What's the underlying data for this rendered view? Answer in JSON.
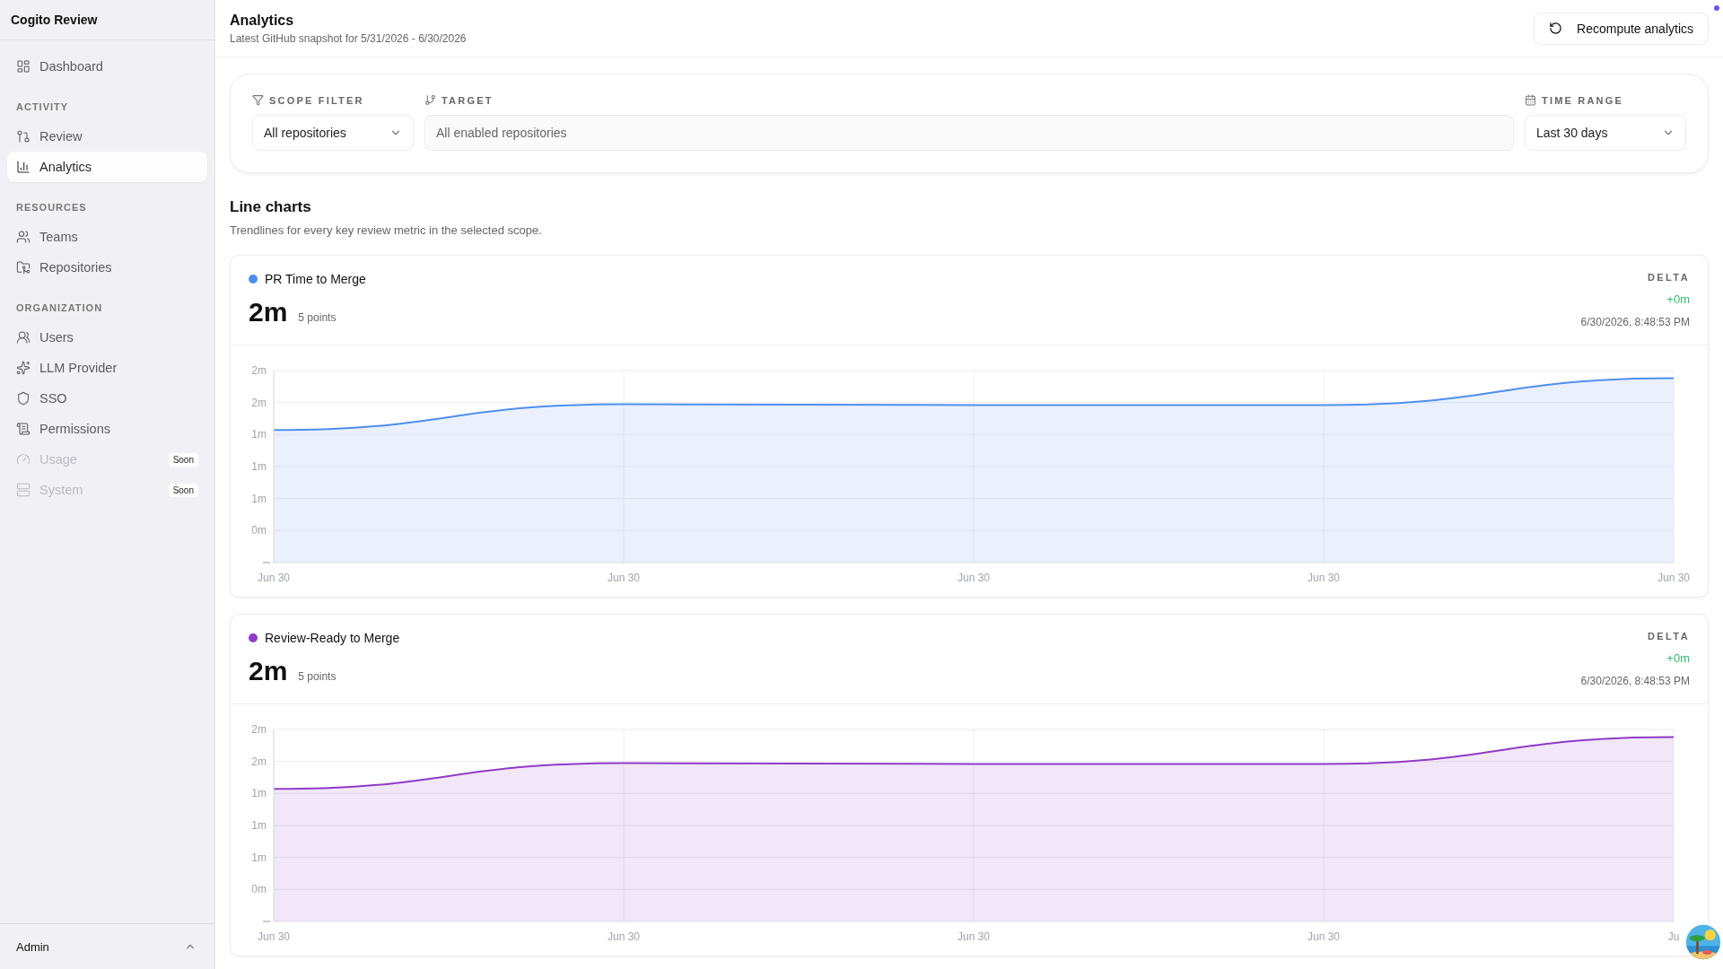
{
  "app": {
    "title": "Cogito Review"
  },
  "sidebar": {
    "items": [
      {
        "label": "Dashboard",
        "selected": false,
        "disabled": false
      }
    ],
    "sections": [
      {
        "heading": "ACTIVITY",
        "items": [
          {
            "label": "Review",
            "selected": false,
            "disabled": false
          },
          {
            "label": "Analytics",
            "selected": true,
            "disabled": false
          }
        ]
      },
      {
        "heading": "RESOURCES",
        "items": [
          {
            "label": "Teams",
            "selected": false,
            "disabled": false
          },
          {
            "label": "Repositories",
            "selected": false,
            "disabled": false
          }
        ]
      },
      {
        "heading": "ORGANIZATION",
        "items": [
          {
            "label": "Users",
            "selected": false,
            "disabled": false
          },
          {
            "label": "LLM Provider",
            "selected": false,
            "disabled": false
          },
          {
            "label": "SSO",
            "selected": false,
            "disabled": false
          },
          {
            "label": "Permissions",
            "selected": false,
            "disabled": false
          },
          {
            "label": "Usage",
            "selected": false,
            "disabled": true,
            "badge": "Soon"
          },
          {
            "label": "System",
            "selected": false,
            "disabled": true,
            "badge": "Soon"
          }
        ]
      }
    ],
    "footer": {
      "user": "Admin"
    }
  },
  "header": {
    "title": "Analytics",
    "subtitle": "Latest GitHub snapshot for 5/31/2026 - 6/30/2026",
    "button": "Recompute analytics"
  },
  "filters": [
    {
      "label": "SCOPE FILTER",
      "value": "All repositories",
      "kind": "select"
    },
    {
      "label": "TARGET",
      "value": "All enabled repositories",
      "kind": "readonly"
    },
    {
      "label": "TIME RANGE",
      "value": "Last 30 days",
      "kind": "select"
    }
  ],
  "section": {
    "title": "Line charts",
    "subtitle": "Trendlines for every key review metric in the selected scope."
  },
  "cards": [
    {
      "name": "PR Time to Merge",
      "color": "#4f8ef0",
      "value": "2m",
      "points": "5 points",
      "delta_label": "DELTA",
      "delta": "+0m",
      "timestamp": "6/30/2026, 8:48:53 PM",
      "y_labels": [
        "2m",
        "2m",
        "1m",
        "1m",
        "1m",
        "0m"
      ],
      "x_labels": [
        "Jun 30",
        "Jun 30",
        "Jun 30",
        "Jun 30",
        "Jun 30"
      ]
    },
    {
      "name": "Review-Ready to Merge",
      "color": "#8e3cc8",
      "value": "2m",
      "points": "5 points",
      "delta_label": "DELTA",
      "delta": "+0m",
      "timestamp": "6/30/2026, 8:48:53 PM",
      "y_labels": [
        "2m",
        "2m",
        "1m",
        "1m",
        "1m",
        "0m"
      ],
      "x_labels": [
        "Jun 30",
        "Jun 30",
        "Jun 30",
        "Jun 30",
        "Ju"
      ]
    }
  ]
}
